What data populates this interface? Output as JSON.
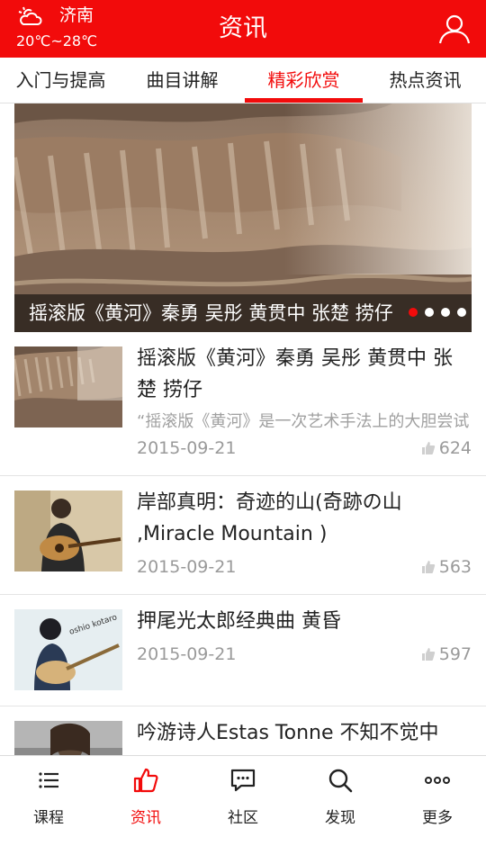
{
  "header": {
    "city": "济南",
    "temperature": "20℃~28℃",
    "title": "资讯",
    "weather_icon": "cloud-sun-icon",
    "user_icon": "user-icon"
  },
  "tabs": [
    {
      "label": "入门与提高",
      "active": false
    },
    {
      "label": "曲目讲解",
      "active": false
    },
    {
      "label": "精彩欣赏",
      "active": true
    },
    {
      "label": "热点资讯",
      "active": false
    }
  ],
  "banner": {
    "caption": "摇滚版《黄河》秦勇 吴彤 黄贯中 张楚 捞仔",
    "slide_count": 4,
    "active_slide": 1
  },
  "news": [
    {
      "title": "摇滚版《黄河》秦勇 吴彤 黄贯中 张楚 捞仔",
      "summary": "“摇滚版《黄河》是一次艺术手法上的大胆尝试",
      "date": "2015-09-21",
      "likes": "624"
    },
    {
      "title": "岸部真明：奇迹的山(奇跡の山 ,Miracle Mountain )",
      "summary": "",
      "date": "2015-09-21",
      "likes": "563"
    },
    {
      "title": "押尾光太郎经典曲 黄昏",
      "summary": "",
      "date": "2015-09-21",
      "likes": "597",
      "thumb_text": "oshio kotaro"
    },
    {
      "title": "吟游诗人Estas Tonne 不知不觉中",
      "summary": "",
      "date": "",
      "likes": ""
    }
  ],
  "bottom_nav": [
    {
      "label": "课程",
      "icon": "list-icon",
      "active": false
    },
    {
      "label": "资讯",
      "icon": "thumbs-up-icon",
      "active": true
    },
    {
      "label": "社区",
      "icon": "chat-icon",
      "active": false
    },
    {
      "label": "发现",
      "icon": "search-icon",
      "active": false
    },
    {
      "label": "更多",
      "icon": "more-icon",
      "active": false
    }
  ],
  "colors": {
    "accent": "#f20b0b",
    "muted_text": "#9a9a9a"
  }
}
